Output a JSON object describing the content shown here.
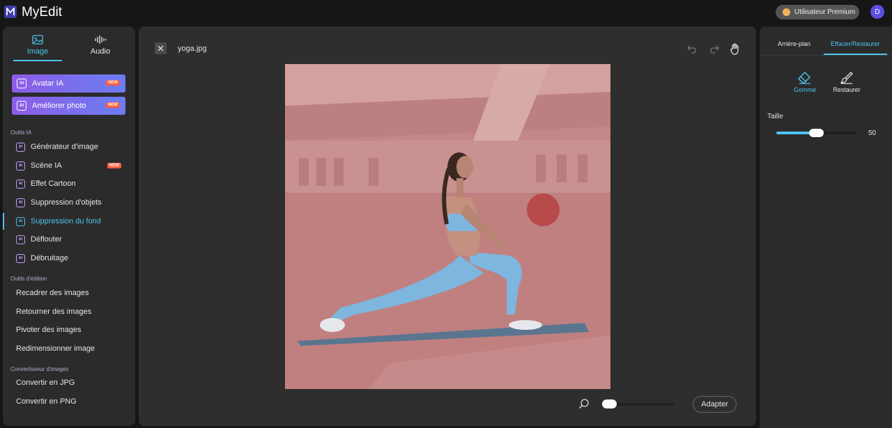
{
  "header": {
    "app_title": "MyEdit",
    "premium_label": "Utilisateur Premium",
    "avatar_initial": "D"
  },
  "sidebar": {
    "modes": [
      {
        "label": "Image",
        "icon": "image-icon",
        "active": true
      },
      {
        "label": "Audio",
        "icon": "audio-wave-icon",
        "active": false
      }
    ],
    "promos": [
      {
        "label": "Avatar IA",
        "badge": "NEW"
      },
      {
        "label": "Améliorer photo",
        "badge": "NEW"
      }
    ],
    "ai_section_label": "Outils IA",
    "ai_tools": [
      {
        "label": "Générateur d'image"
      },
      {
        "label": "Scène IA",
        "badge": "NEW"
      },
      {
        "label": "Effet Cartoon"
      },
      {
        "label": "Suppression d'objets"
      },
      {
        "label": "Suppression du fond",
        "active": true
      },
      {
        "label": "Déflouter"
      },
      {
        "label": "Débruitage"
      }
    ],
    "edit_section_label": "Outils d'édition",
    "edit_tools": [
      {
        "label": "Recadrer des images"
      },
      {
        "label": "Retourner des images"
      },
      {
        "label": "Pivoter des images"
      },
      {
        "label": "Redimensionner image"
      }
    ],
    "convert_section_label": "Convertisseur d'images",
    "convert_tools": [
      {
        "label": "Convertir en JPG"
      },
      {
        "label": "Convertir en PNG"
      }
    ],
    "ai_badge_text": "AI"
  },
  "canvas": {
    "filename": "yoga.jpg",
    "adapt_label": "Adapter",
    "zoom_level": 0.0
  },
  "right_panel": {
    "tabs": [
      {
        "label": "Arrière-plan",
        "active": false
      },
      {
        "label": "Effacer/Restaurer",
        "active": true
      }
    ],
    "tools": [
      {
        "label": "Gomme",
        "icon": "eraser-icon",
        "active": true
      },
      {
        "label": "Restaurer",
        "icon": "brush-icon",
        "active": false
      }
    ],
    "size_label": "Taille",
    "size_value": "50",
    "size_fraction": 0.5
  },
  "colors": {
    "accent": "#4ec3f0",
    "new_badge": "#ff5c3a",
    "mask_overlay": "#c98a8a"
  }
}
